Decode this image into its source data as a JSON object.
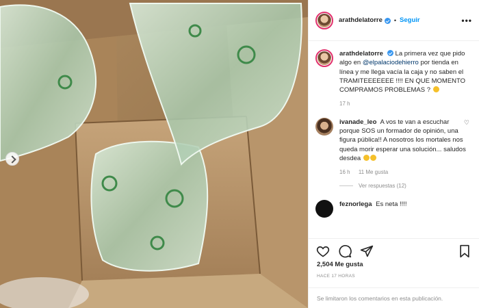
{
  "header": {
    "username": "arathdelatorre",
    "follow_label": "Seguir",
    "more_glyph": "•••"
  },
  "caption": {
    "username": "arathdelatorre",
    "text_before": "La primera vez que pido algo en",
    "mention": "@elpalaciodehierro",
    "text_after": "por tienda en línea y me llega vacía la caja y no saben el TRAMITEEEEEEE !!!! EN QUE MOMENTO COMPRAMOS PROBLEMAS ?",
    "time": "17 h"
  },
  "comments": [
    {
      "username": "ivanade_leo",
      "text": "A vos te van a escuchar porque SOS un formador de opinión, una figura pública!! A nosotros los mortales nos queda morir esperar una solución... saludos desdea",
      "time": "16 h",
      "likes": "11 Me gusta",
      "replies_label": "Ver respuestas (12)"
    },
    {
      "username": "feznorlega",
      "text": "Es neta !!!!"
    }
  ],
  "actions": {
    "icons": [
      "heart-icon",
      "comment-icon",
      "share-icon",
      "bookmark-icon"
    ]
  },
  "likes_count": "2,504 Me gusta",
  "timestamp": "HACE 17 HORAS",
  "comments_limited": "Se limitaron los comentarios en esta publicación."
}
